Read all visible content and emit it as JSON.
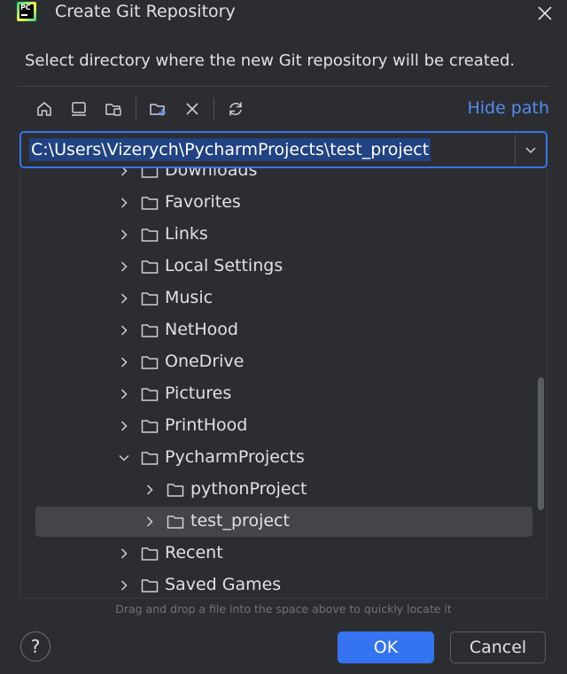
{
  "dialog": {
    "title": "Create Git Repository",
    "subtitle": "Select directory where the new Git repository will be created.",
    "app_icon": "pycharm-icon",
    "app_icon_text": "PC"
  },
  "toolbar": {
    "icons": [
      "home-icon",
      "desktop-icon",
      "project-folder-icon",
      "new-folder-icon",
      "delete-icon",
      "refresh-icon"
    ],
    "hide_path_label": "Hide path"
  },
  "path": {
    "value": "C:\\Users\\Vizerych\\PycharmProjects\\test_project"
  },
  "tree": {
    "items": [
      {
        "label": "Downloads",
        "depth": 0,
        "expanded": false,
        "selected": false
      },
      {
        "label": "Favorites",
        "depth": 0,
        "expanded": false,
        "selected": false
      },
      {
        "label": "Links",
        "depth": 0,
        "expanded": false,
        "selected": false
      },
      {
        "label": "Local Settings",
        "depth": 0,
        "expanded": false,
        "selected": false
      },
      {
        "label": "Music",
        "depth": 0,
        "expanded": false,
        "selected": false
      },
      {
        "label": "NetHood",
        "depth": 0,
        "expanded": false,
        "selected": false
      },
      {
        "label": "OneDrive",
        "depth": 0,
        "expanded": false,
        "selected": false
      },
      {
        "label": "Pictures",
        "depth": 0,
        "expanded": false,
        "selected": false
      },
      {
        "label": "PrintHood",
        "depth": 0,
        "expanded": false,
        "selected": false
      },
      {
        "label": "PycharmProjects",
        "depth": 0,
        "expanded": true,
        "selected": false
      },
      {
        "label": "pythonProject",
        "depth": 1,
        "expanded": false,
        "selected": false
      },
      {
        "label": "test_project",
        "depth": 1,
        "expanded": false,
        "selected": true
      },
      {
        "label": "Recent",
        "depth": 0,
        "expanded": false,
        "selected": false
      },
      {
        "label": "Saved Games",
        "depth": 0,
        "expanded": false,
        "selected": false
      }
    ]
  },
  "hint": "Drag and drop a file into the space above to quickly locate it",
  "footer": {
    "help_label": "?",
    "ok_label": "OK",
    "cancel_label": "Cancel"
  },
  "colors": {
    "background": "#2b2d30",
    "accent": "#3574f0",
    "link": "#548af7",
    "selection": "#214283",
    "row_selected": "#43454a"
  }
}
